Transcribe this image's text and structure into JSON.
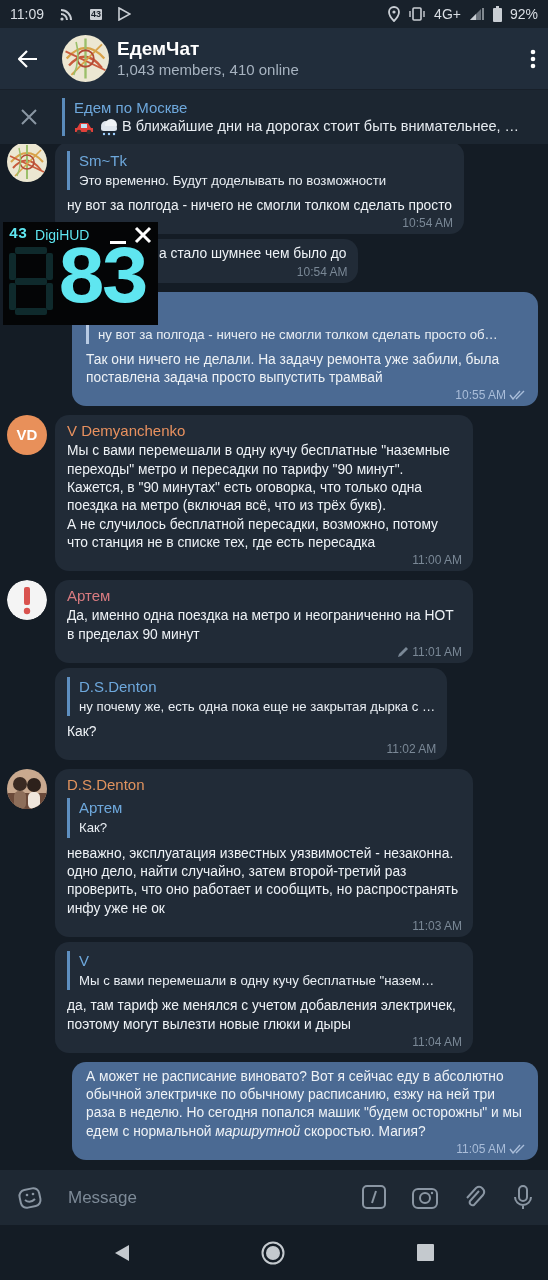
{
  "status_bar": {
    "time": "11:09",
    "notification_badge": "43",
    "network": "4G+",
    "battery": "92%"
  },
  "header": {
    "title": "ЕдемЧат",
    "subtitle": "1,043 members, 410 online"
  },
  "pinned": {
    "title": "Едем по Москве",
    "text": "В ближайшие дни на дорогах стоит быть внимательнее, …"
  },
  "messages": [
    {
      "kind": "incoming",
      "reply": {
        "name": "Sm~Tk",
        "text": "Это временно. Будут доделывать по возможности"
      },
      "text": "ну вот за полгода - ничего не смогли толком сделать просто",
      "time": "10:54 AM",
      "covered": false
    },
    {
      "kind": "incoming",
      "text": "а стало шумнее чем было до",
      "time": "10:54 AM",
      "covered": true
    },
    {
      "kind": "outgoing",
      "reply": {
        "text": "ну вот за полгода - ничего не смогли толком сделать просто об…"
      },
      "text": "Так они ничего не делали. На задачу ремонта уже забили, была поставлена задача просто выпустить трамвай",
      "time": "10:55 AM",
      "read": true
    },
    {
      "kind": "incoming",
      "avatar": {
        "kind": "initials",
        "text": "VD",
        "color": "#e8905a"
      },
      "sender": "V Demyanchenko",
      "color": "#e8915f",
      "text": "Мы с вами перемешали в одну кучу бесплатные \"наземные переходы\" метро и пересадки по тарифу \"90 минут\". Кажется, в \"90 минутах\" есть оговорка, что только одна поездка на метро (включая всё, что из трёх букв).\nА не случилось бесплатной пересадки, возможно, потому что станция не в списке тех, где есть пересадка",
      "time": "11:00 AM",
      "covered": false
    },
    {
      "kind": "incoming",
      "avatar": {
        "kind": "alert"
      },
      "sender": "Артем",
      "color": "#d97b80",
      "text": "Да, именно одна поездка на метро и неограниченно на НОТ в пределах 90 минут",
      "time": "11:01 AM",
      "edited": true,
      "covered": false
    },
    {
      "kind": "incoming",
      "reply": {
        "name": "D.S.Denton",
        "text": "ну почему же, есть одна пока еще не закрытая дырка с …"
      },
      "text": "Как?",
      "time": "11:02 AM",
      "covered": false
    },
    {
      "kind": "incoming",
      "sender": "D.S.Denton",
      "color": "#e0935e",
      "reply": {
        "name": "Артем",
        "text": "Как?"
      },
      "text": "неважно, эксплуатация известных уязвимостей - незаконна. одно дело, найти случайно, затем второй-третий раз проверить, что оно работает и сообщить, но распространять инфу уже не ок",
      "time": "11:03 AM",
      "covered": false
    },
    {
      "kind": "incoming",
      "reply": {
        "name": "V",
        "text": "Мы с вами перемешали в одну кучу бесплатные \"назем…"
      },
      "text": "да, там тариф же менялся с учетом добавления электричек, поэтому могут вылезти новые глюки и дыры",
      "time": "11:04 AM",
      "covered": false
    },
    {
      "kind": "outgoing",
      "text": "А может не расписание виновато? Вот я сейчас еду в абсолютно обычной электричке по обычному расписанию, езжу на ней три раза в неделю. Но сегодня попался машик \"будем осторожны\" и мы едем с нормальной *маршрутной* скоростью. Магия?",
      "time": "11:05 AM",
      "read": true
    }
  ],
  "hud": {
    "badge": "43",
    "title": "DigiHUD",
    "speed": "83"
  },
  "composer": {
    "placeholder": "Message"
  }
}
